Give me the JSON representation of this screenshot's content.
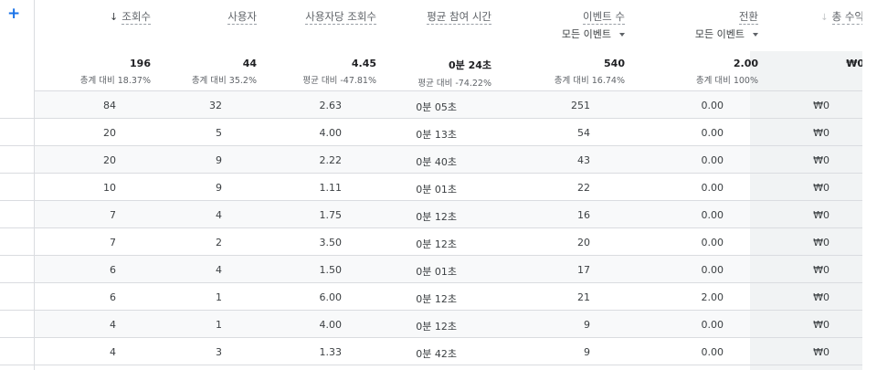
{
  "header": {
    "add_icon": "+",
    "sort_icon": "arrow-down-icon",
    "columns": {
      "views": "조회수",
      "users": "사용자",
      "views_per_user": "사용자당 조회수",
      "avg_engagement": "평균 참여 시간",
      "events": "이벤트 수",
      "events_sub": "모든 이벤트",
      "conversions": "전환",
      "conversions_sub": "모든 이벤트",
      "revenue": "총 수익"
    }
  },
  "totals": {
    "views": "196",
    "views_sub": "총계 대비 18.37%",
    "users": "44",
    "users_sub": "총계 대비 35.2%",
    "views_per_user": "4.45",
    "views_per_user_sub": "평균 대비 -47.81%",
    "avg_engagement": "0분 24초",
    "avg_engagement_sub": "평균 대비 -74.22%",
    "events": "540",
    "events_sub": "총계 대비 16.74%",
    "conversions": "2.00",
    "conversions_sub": "총계 대비 100%",
    "revenue": "₩0"
  },
  "rows": [
    {
      "views": "84",
      "users": "32",
      "vpu": "2.63",
      "time": "0분 05초",
      "events": "251",
      "conv": "0.00",
      "rev": "₩0"
    },
    {
      "views": "20",
      "users": "5",
      "vpu": "4.00",
      "time": "0분 13초",
      "events": "54",
      "conv": "0.00",
      "rev": "₩0"
    },
    {
      "views": "20",
      "users": "9",
      "vpu": "2.22",
      "time": "0분 40초",
      "events": "43",
      "conv": "0.00",
      "rev": "₩0"
    },
    {
      "views": "10",
      "users": "9",
      "vpu": "1.11",
      "time": "0분 01초",
      "events": "22",
      "conv": "0.00",
      "rev": "₩0"
    },
    {
      "views": "7",
      "users": "4",
      "vpu": "1.75",
      "time": "0분 12초",
      "events": "16",
      "conv": "0.00",
      "rev": "₩0"
    },
    {
      "views": "7",
      "users": "2",
      "vpu": "3.50",
      "time": "0분 12초",
      "events": "20",
      "conv": "0.00",
      "rev": "₩0"
    },
    {
      "views": "6",
      "users": "4",
      "vpu": "1.50",
      "time": "0분 01초",
      "events": "17",
      "conv": "0.00",
      "rev": "₩0"
    },
    {
      "views": "6",
      "users": "1",
      "vpu": "6.00",
      "time": "0분 12초",
      "events": "21",
      "conv": "2.00",
      "rev": "₩0"
    },
    {
      "views": "4",
      "users": "1",
      "vpu": "4.00",
      "time": "0분 12초",
      "events": "9",
      "conv": "0.00",
      "rev": "₩0"
    },
    {
      "views": "4",
      "users": "3",
      "vpu": "1.33",
      "time": "0분 42초",
      "events": "9",
      "conv": "0.00",
      "rev": "₩0"
    }
  ],
  "colors": {
    "accent": "#1a73e8",
    "row_shade": "#f8f9fa",
    "revenue_bg": "#f1f3f4",
    "border": "#dadce0"
  }
}
